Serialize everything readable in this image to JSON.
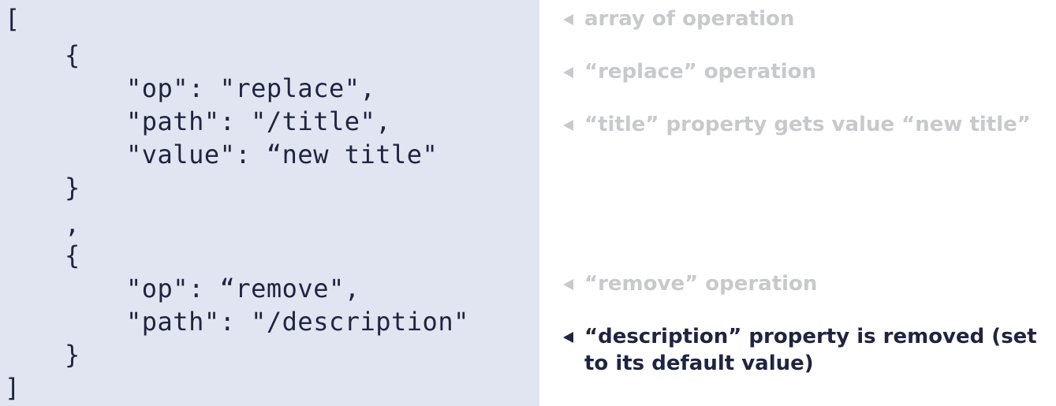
{
  "code_lines": [
    "[",
    "{",
    "\"op\": \"replace\",",
    "\"path\": \"/title\",",
    "\"value\": “new title\"",
    "}",
    ",",
    "{",
    "\"op\": “remove\",",
    "\"path\": \"/description\"",
    "}",
    "]"
  ],
  "annotations": [
    {
      "text": "array of operation",
      "state": "muted"
    },
    {
      "text": "“replace” operation",
      "state": "muted"
    },
    {
      "text": "“title” property gets value “new title”",
      "state": "muted"
    },
    {
      "text": "“remove” operation",
      "state": "muted"
    },
    {
      "text": "“description” property is removed (set to its default value)",
      "state": "active"
    }
  ],
  "colors": {
    "code_background": "#e1e5f1",
    "code_text": "#1f2440",
    "annotation_muted": "#c8c9cd",
    "annotation_active": "#1f2440"
  },
  "icons": {
    "annotation_marker": "triangle-left-icon"
  }
}
